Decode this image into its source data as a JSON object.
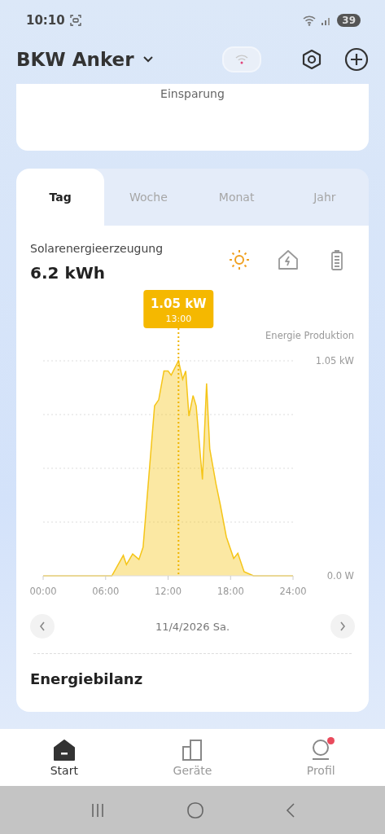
{
  "status_bar": {
    "time": "10:10",
    "battery": "39"
  },
  "header": {
    "title": "BKW Anker"
  },
  "summary_card": {
    "label": "Einsparung"
  },
  "period_tabs": [
    {
      "label": "Tag",
      "selected": true
    },
    {
      "label": "Woche",
      "selected": false
    },
    {
      "label": "Monat",
      "selected": false
    },
    {
      "label": "Jahr",
      "selected": false
    }
  ],
  "production": {
    "title": "Solarenergieerzeugung",
    "value": "6.2 kWh",
    "views": [
      {
        "kind": "solar",
        "selected": true
      },
      {
        "kind": "home",
        "selected": false
      },
      {
        "kind": "battery",
        "selected": false
      }
    ],
    "chart_data": {
      "type": "area",
      "x": [
        0,
        6.6,
        7.7,
        8.0,
        8.6,
        9.2,
        9.6,
        10.7,
        11.1,
        11.6,
        12.0,
        12.3,
        13.0,
        13.4,
        13.7,
        14.0,
        14.4,
        14.7,
        15.3,
        15.7,
        16.0,
        16.6,
        17.0,
        17.6,
        18.3,
        18.7,
        19.3,
        20.2,
        24
      ],
      "series": [
        {
          "name": "Energie Produktion",
          "color": "#f5c518",
          "values": [
            0,
            0,
            0.1,
            0.055,
            0.107,
            0.08,
            0.14,
            0.83,
            0.86,
            1.0,
            1.0,
            0.98,
            1.05,
            0.96,
            1.0,
            0.78,
            0.88,
            0.83,
            0.47,
            0.94,
            0.62,
            0.45,
            0.35,
            0.19,
            0.085,
            0.11,
            0.02,
            0,
            0
          ]
        }
      ],
      "xlim": [
        0,
        24
      ],
      "ylim": [
        0,
        1.05
      ],
      "xticks": [
        {
          "value": 0,
          "label": "00:00"
        },
        {
          "value": 6,
          "label": "06:00"
        },
        {
          "value": 12,
          "label": "12:00"
        },
        {
          "value": 18,
          "label": "18:00"
        },
        {
          "value": 24,
          "label": "24:00"
        }
      ],
      "yticks": [
        {
          "value": 0,
          "label": "0.0 W"
        },
        {
          "value": 1.05,
          "label": "1.05 kW"
        }
      ],
      "ref_lines": [
        {
          "axis": "x",
          "value": 13,
          "color": "#f0b400"
        }
      ]
    },
    "tooltip": {
      "value": "1.05 kW",
      "time": "13:00"
    }
  },
  "date_nav": {
    "date": "11/4/2026 Sa."
  },
  "balance": {
    "title": "Energiebilanz"
  },
  "bottom_nav": [
    {
      "label": "Start",
      "kind": "home",
      "selected": true,
      "badge": false
    },
    {
      "label": "Geräte",
      "kind": "devices",
      "selected": false,
      "badge": false
    },
    {
      "label": "Profil",
      "kind": "profile",
      "selected": false,
      "badge": true
    }
  ]
}
